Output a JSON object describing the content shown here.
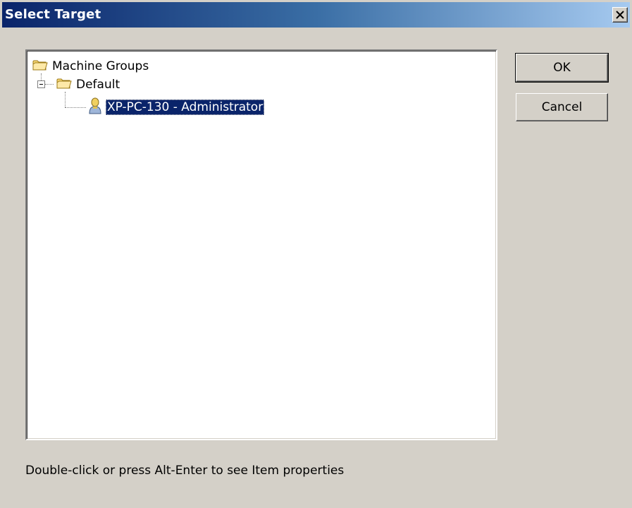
{
  "window": {
    "title": "Select Target",
    "close_label": "Close"
  },
  "tree": {
    "root": {
      "label": "Machine Groups",
      "icon": "folder-icon"
    },
    "group": {
      "label": "Default",
      "icon": "open-folder-icon",
      "expanded": true
    },
    "item": {
      "label": "XP-PC-130 - Administrator",
      "icon": "user-icon",
      "selected": true
    }
  },
  "buttons": {
    "ok_label": "OK",
    "cancel_label": "Cancel"
  },
  "status": {
    "hint": "Double-click or press Alt-Enter to see Item properties"
  },
  "colors": {
    "titlebar_start": "#0a246a",
    "titlebar_end": "#a6caf0",
    "selection": "#0a246a",
    "dialog_bg": "#d4d0c8"
  }
}
